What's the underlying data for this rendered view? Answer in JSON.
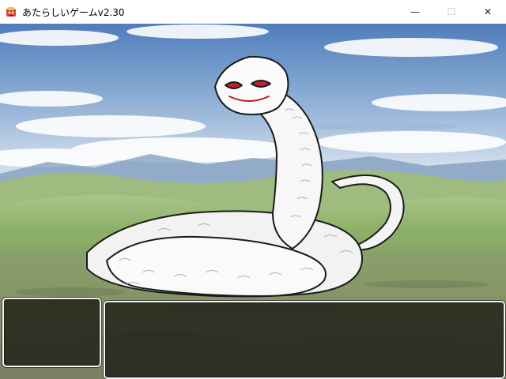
{
  "window": {
    "title": "あたらしいゲームv2.30",
    "controls": {
      "minimize_glyph": "—",
      "maximize_glyph": "☐",
      "close_glyph": "✕"
    }
  },
  "icons": {
    "app": "game-app-icon",
    "minimize": "minimize-icon",
    "maximize": "maximize-icon",
    "close": "close-icon"
  },
  "scene": {
    "battleback": "grassland-plain-under-cloudy-sky",
    "enemy": "white-serpent"
  },
  "battle_windows": {
    "party_status_text": "",
    "message_text": ""
  },
  "colors": {
    "sky_top": "#4f7dbb",
    "sky_horizon": "#cfdceb",
    "grass": "#8fb26a",
    "window_fill": "#1a1a14",
    "window_border": "#f5f5f5"
  }
}
